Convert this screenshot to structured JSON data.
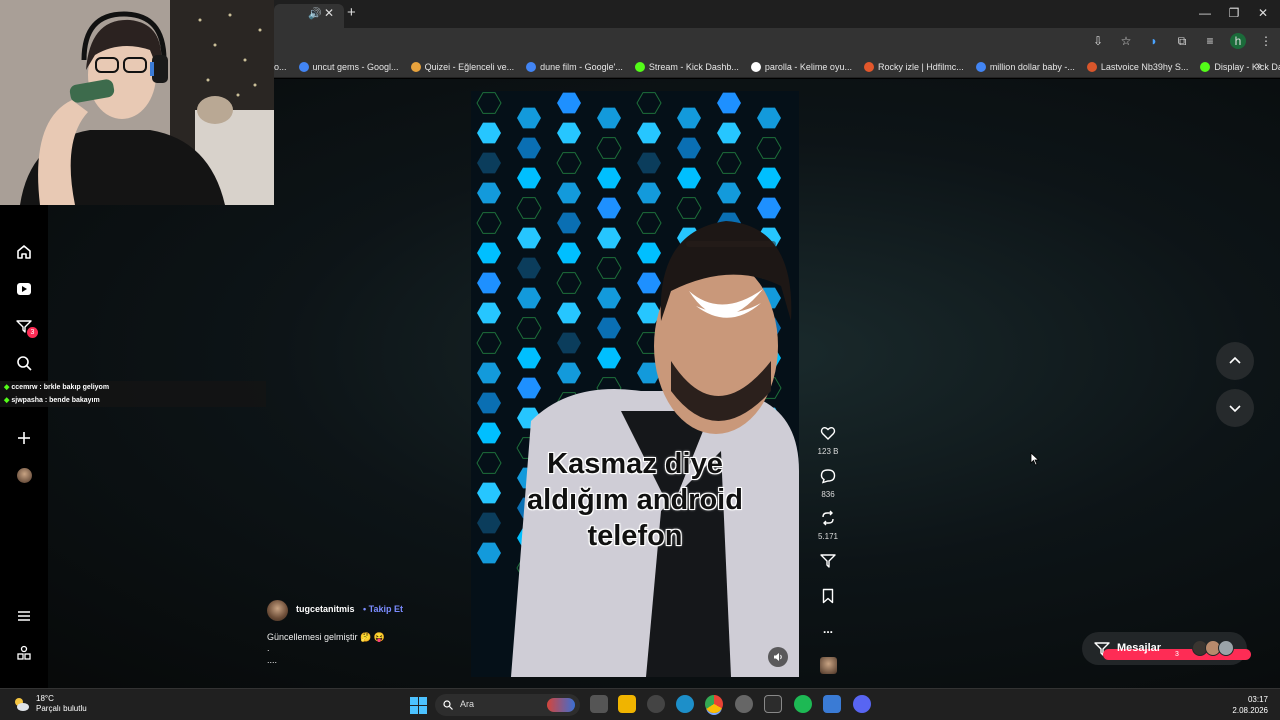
{
  "browser": {
    "bookmarks": [
      {
        "label": "o...",
        "color": "#888"
      },
      {
        "label": "uncut gems - Googl...",
        "color": "#4285f4"
      },
      {
        "label": "Quizei - Eğlenceli ve...",
        "color": "#e8a33d"
      },
      {
        "label": "dune film - Google'...",
        "color": "#4285f4"
      },
      {
        "label": "Stream - Kick Dashb...",
        "color": "#53fc18"
      },
      {
        "label": "parolla - Kelime oyu...",
        "color": "#ffffff"
      },
      {
        "label": "Rocky izle | Hdfilmc...",
        "color": "#e2572b"
      },
      {
        "label": "million dollar baby -...",
        "color": "#4285f4"
      },
      {
        "label": "Lastvoice Nb39hy S...",
        "color": "#d9562b"
      },
      {
        "label": "Display - Kick Dash...",
        "color": "#53fc18"
      }
    ],
    "more_bookmarks_icon": "chevrons-right-icon",
    "profile_initial": "h"
  },
  "sidebar": {
    "items": [
      {
        "name": "home-icon",
        "badge": ""
      },
      {
        "name": "following-icon",
        "badge": ""
      },
      {
        "name": "inbox-icon",
        "badge": "3"
      },
      {
        "name": "search-icon",
        "badge": ""
      },
      {
        "name": "upload-icon",
        "badge": ""
      },
      {
        "name": "profile-icon",
        "badge": ""
      }
    ]
  },
  "chat": {
    "lines": [
      {
        "user": "ccemrw",
        "text": "brkle bakıp geliyom"
      },
      {
        "user": "sjwpasha",
        "text": "bende bakayım"
      }
    ]
  },
  "video": {
    "caption_lines": [
      "Kasmaz diye",
      "aldığım android",
      "telefon"
    ],
    "likes": "123 B",
    "comments": "836",
    "shares": "5.171",
    "more": "...",
    "author": "tugcetanitmis",
    "follow_label": "Takip Et",
    "description": "Güncellemesi gelmiştir 🤔 😝",
    "description_more_1": ".",
    "description_more_2": "...."
  },
  "messages": {
    "label": "Mesajlar",
    "badge": "3"
  },
  "taskbar": {
    "temperature": "18°C",
    "weather": "Parçalı bulutlu",
    "search_label": "Ara",
    "time": "03:17",
    "date": "2.08.2026"
  },
  "colors": {
    "accent": "#fe2c55",
    "follow": "#7b8cff",
    "kick": "#53fc18"
  }
}
